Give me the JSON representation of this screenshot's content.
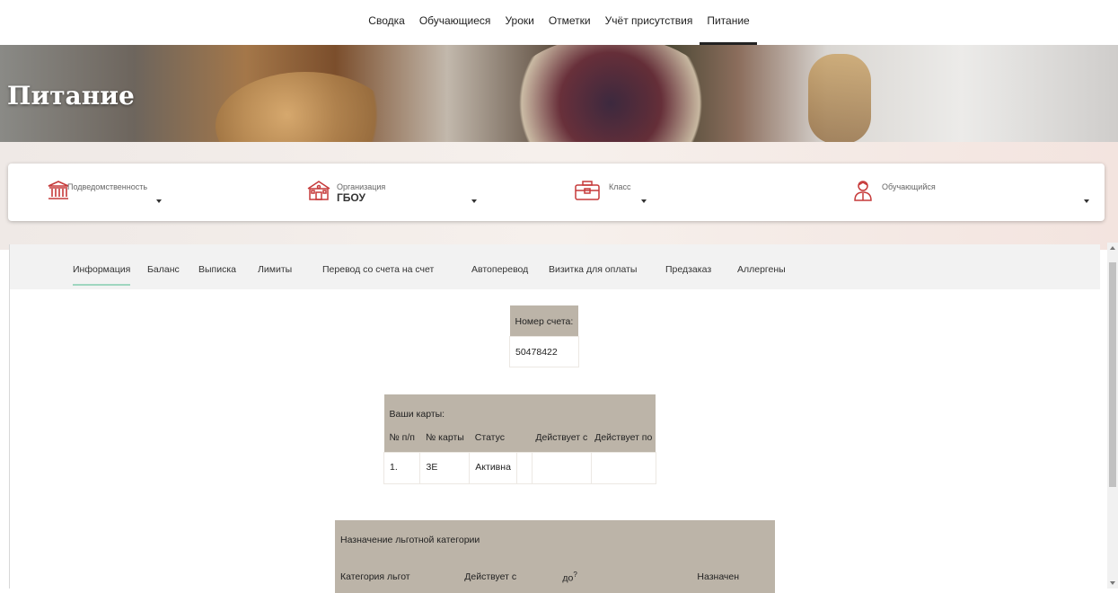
{
  "topnav": {
    "items": [
      {
        "label": "Сводка"
      },
      {
        "label": "Обучающиеся"
      },
      {
        "label": "Уроки"
      },
      {
        "label": "Отметки"
      },
      {
        "label": "Учёт присутствия"
      },
      {
        "label": "Питание",
        "active": true
      }
    ]
  },
  "hero": {
    "title": "Питание"
  },
  "filters": {
    "subordination": {
      "label": "Подведомственность",
      "value": "",
      "icon": "columns-building-icon"
    },
    "organization": {
      "label": "Организация",
      "value": "ГБОУ",
      "icon": "school-building-icon"
    },
    "class": {
      "label": "Класс",
      "value": "",
      "icon": "briefcase-icon"
    },
    "student": {
      "label": "Обучающийся",
      "value": "",
      "icon": "student-icon"
    }
  },
  "tabs": [
    {
      "label": "Информация",
      "active": true
    },
    {
      "label": "Баланс"
    },
    {
      "label": "Выписка"
    },
    {
      "label": "Лимиты"
    },
    {
      "label": "Перевод со счета на счет"
    },
    {
      "label": "Автоперевод"
    },
    {
      "label": "Визитка для оплаты"
    },
    {
      "label": "Предзаказ"
    },
    {
      "label": "Аллергены"
    }
  ],
  "account": {
    "header": "Номер счета:",
    "number": "50478422"
  },
  "cards": {
    "title": "Ваши карты:",
    "columns": [
      "№ п/п",
      "№ карты",
      "Статус",
      "",
      "Действует с",
      "Действует по"
    ],
    "rows": [
      [
        "1.",
        "3E",
        "Активна",
        "",
        "",
        ""
      ]
    ]
  },
  "benefit": {
    "title": "Назначение льготной категории",
    "columns": [
      "Категория льгот",
      "Действует с",
      "до",
      "?",
      "Назначен"
    ]
  },
  "colors": {
    "accent": "#c63a3a",
    "table_header": "#bcb4a8",
    "tab_underline": "#9fd6bf"
  }
}
